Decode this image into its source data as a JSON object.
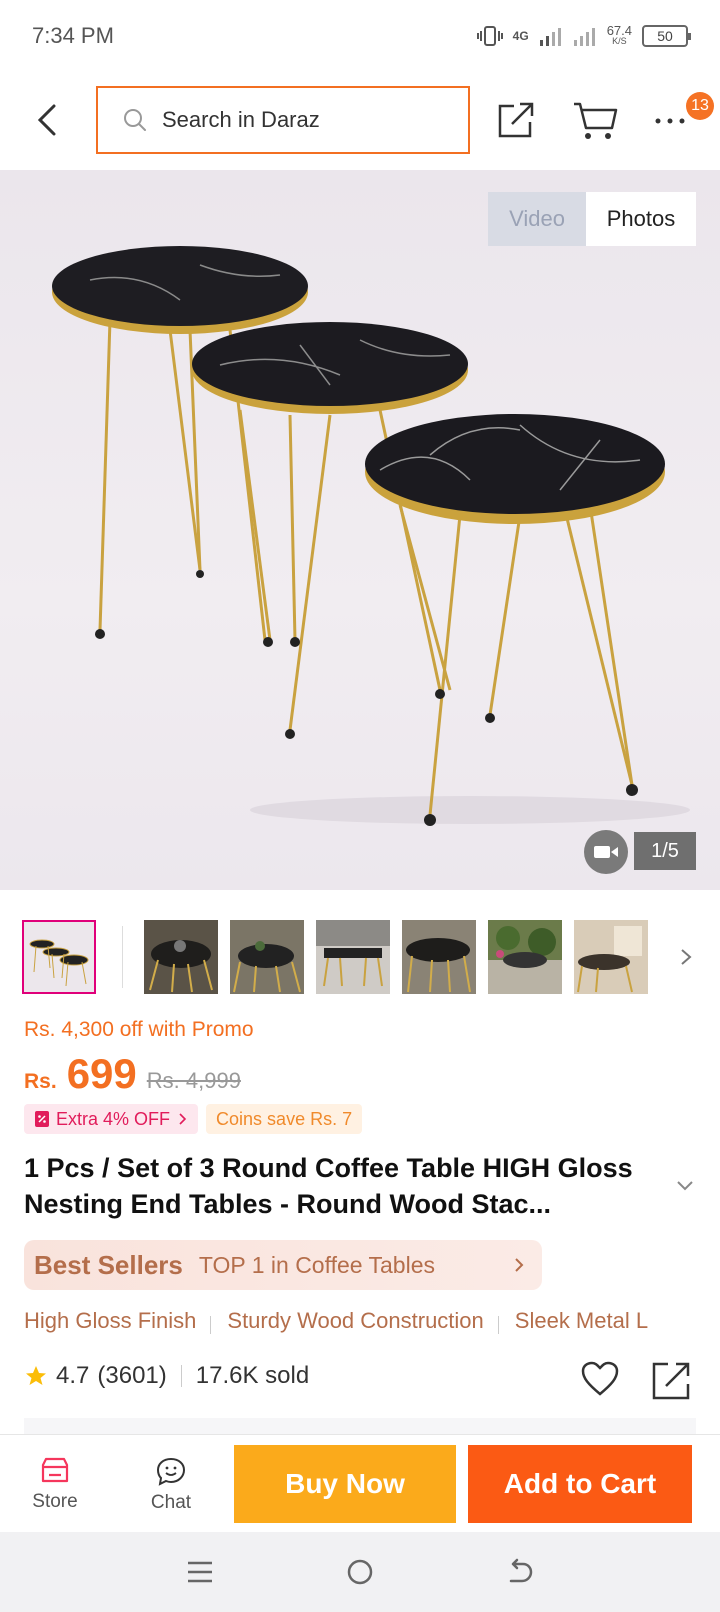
{
  "status_bar": {
    "time": "7:34 PM",
    "network": "4G",
    "speed_value": "67.4",
    "speed_unit": "K/S",
    "battery": "50"
  },
  "nav": {
    "search_placeholder": "Search in Daraz",
    "cart_badge": "13"
  },
  "gallery": {
    "tabs": [
      "Video",
      "Photos"
    ],
    "active_tab": "Photos",
    "counter": "1/5"
  },
  "price": {
    "promo_off": "Rs. 4,300 off with Promo",
    "currency": "Rs.",
    "current": "699",
    "original": "Rs. 4,999",
    "chip_extra": "Extra 4% OFF",
    "chip_coins": "Coins save Rs. 7"
  },
  "product": {
    "title": "1 Pcs / Set of 3 Round Coffee Table HIGH Gloss Nesting End Tables - Round Wood Stac..."
  },
  "best_sellers": {
    "badge": "Best Sellers",
    "text": "TOP 1 in Coffee Tables"
  },
  "features": [
    "High Gloss Finish",
    "Sturdy Wood Construction",
    "Sleek Metal L"
  ],
  "rating": {
    "score": "4.7",
    "count": "(3601)",
    "sold": "17.6K sold"
  },
  "actions": {
    "store": "Store",
    "chat": "Chat",
    "buy_now": "Buy Now",
    "add_to_cart": "Add to Cart"
  },
  "colors": {
    "accent": "#f36f21",
    "buy_now": "#fbaa1b",
    "add_to_cart": "#fb5a14",
    "best_sellers_text": "#b46e4b"
  }
}
